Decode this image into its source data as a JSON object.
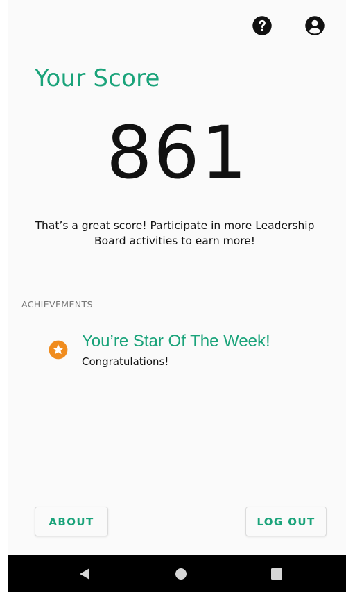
{
  "header": {
    "help_icon": "help-circle-icon",
    "account_icon": "account-circle-icon"
  },
  "score": {
    "title": "Your Score",
    "value": "861",
    "message": "That’s a great score! Participate in more Leadership Board activities to earn more!"
  },
  "achievements": {
    "section_label": "ACHIEVEMENTS",
    "items": [
      {
        "icon": "star-badge-icon",
        "title": "You’re Star Of The Week!",
        "subtitle": "Congratulations!"
      }
    ]
  },
  "actions": {
    "about_label": "ABOUT",
    "logout_label": "LOG OUT"
  },
  "colors": {
    "accent": "#1aa37a",
    "badge": "#f08c1e"
  }
}
